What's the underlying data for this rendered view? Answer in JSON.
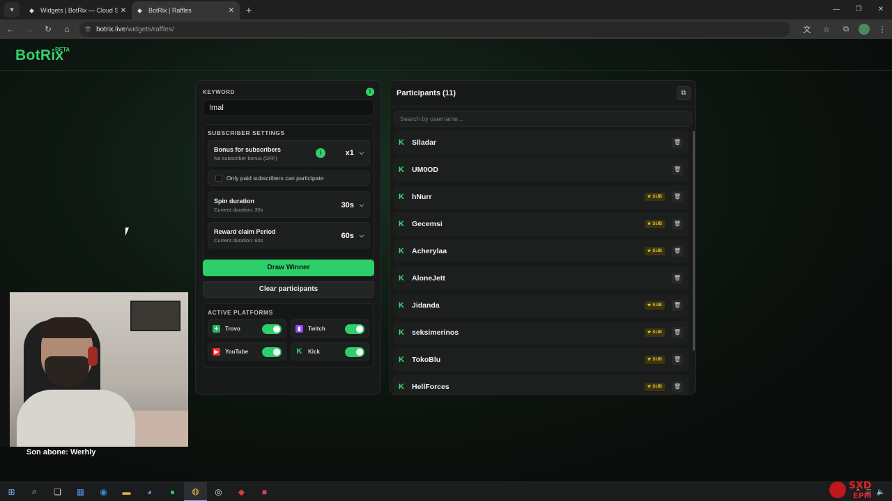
{
  "browser": {
    "tabs": [
      {
        "title": "Widgets | BotRix — Cloud Strea",
        "active": false
      },
      {
        "title": "BotRix | Raffles",
        "active": true
      }
    ],
    "url_host": "botrix.live",
    "url_path": "/widgets/raffles/"
  },
  "brand": {
    "name": "BotRix",
    "badge": "BETA"
  },
  "settings": {
    "keyword_label": "KEYWORD",
    "keyword_value": "!mal",
    "subscriber_title": "SUBSCRIBER SETTINGS",
    "bonus_title": "Bonus for subscribers",
    "bonus_sub": "No subscriber bonus (OFF)",
    "bonus_value": "x1",
    "paid_only_label": "Only paid subscribers can participate",
    "spin_title": "Spin duration",
    "spin_sub": "Current duration: 30s",
    "spin_value": "30s",
    "reward_title": "Reward claim Period",
    "reward_sub": "Current duration: 60s",
    "reward_value": "60s",
    "draw_label": "Draw Winner",
    "clear_label": "Clear participants",
    "platforms_title": "ACTIVE PLATFORMS",
    "platforms": [
      {
        "name": "Trovo",
        "icon": "trovo-icon",
        "color": "#1fb866",
        "enabled": true
      },
      {
        "name": "Twitch",
        "icon": "twitch-icon",
        "color": "#9146ff",
        "enabled": true
      },
      {
        "name": "YouTube",
        "icon": "youtube-icon",
        "color": "#ff2a2a",
        "enabled": true
      },
      {
        "name": "Kick",
        "icon": "kick-icon",
        "color": "#38e06f",
        "enabled": true
      }
    ]
  },
  "participants": {
    "title": "Participants (11)",
    "search_placeholder": "Search by username...",
    "sub_badge": "SUB",
    "items": [
      {
        "name": "Slladar",
        "sub": false
      },
      {
        "name": "UM0OD",
        "sub": false
      },
      {
        "name": "hNurr",
        "sub": true
      },
      {
        "name": "Gecemsi",
        "sub": true
      },
      {
        "name": "Acherylaa",
        "sub": true
      },
      {
        "name": "AloneJett",
        "sub": false
      },
      {
        "name": "Jidanda",
        "sub": true
      },
      {
        "name": "seksimerinos",
        "sub": true
      },
      {
        "name": "TokoBlu",
        "sub": true
      },
      {
        "name": "HellForces",
        "sub": true
      }
    ]
  },
  "overlay": {
    "caption": "Son abone: Werhly"
  },
  "colors": {
    "accent": "#2dcf6a",
    "sub_badge": "#e2c43a"
  }
}
